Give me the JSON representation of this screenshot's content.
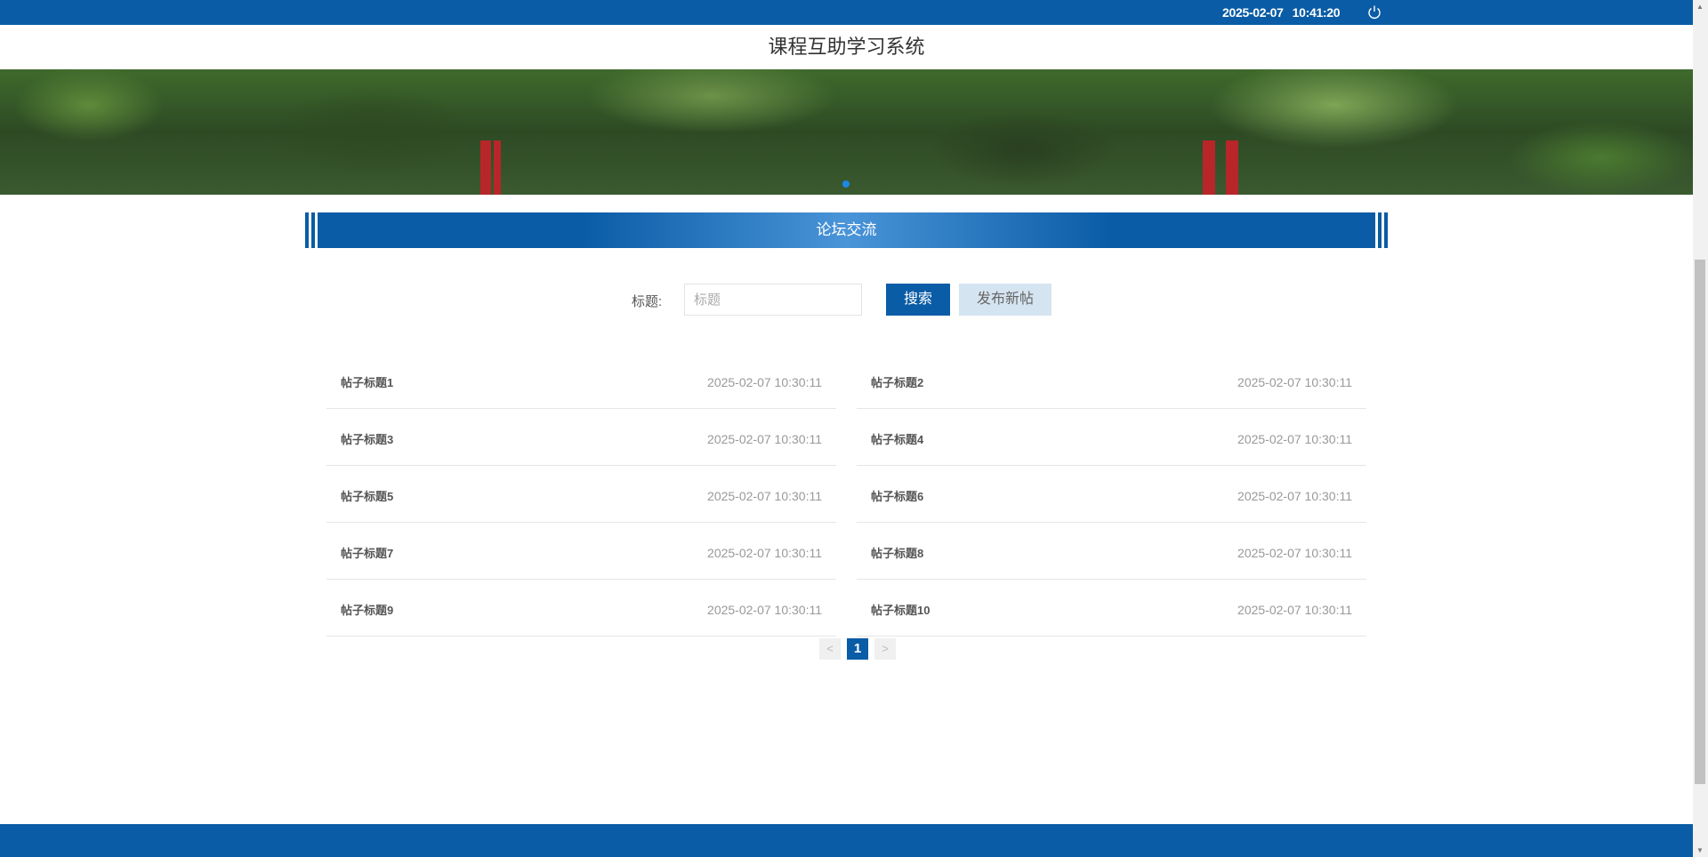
{
  "topbar": {
    "date": "2025-02-07",
    "time": "10:41:20",
    "logout_icon": "power-icon"
  },
  "header": {
    "title": "课程互助学习系统"
  },
  "section": {
    "title": "论坛交流"
  },
  "search": {
    "label": "标题:",
    "placeholder": "标题",
    "value": "",
    "search_button": "搜索",
    "publish_button": "发布新帖"
  },
  "posts": [
    {
      "title": "帖子标题1",
      "time": "2025-02-07 10:30:11"
    },
    {
      "title": "帖子标题2",
      "time": "2025-02-07 10:30:11"
    },
    {
      "title": "帖子标题3",
      "time": "2025-02-07 10:30:11"
    },
    {
      "title": "帖子标题4",
      "time": "2025-02-07 10:30:11"
    },
    {
      "title": "帖子标题5",
      "time": "2025-02-07 10:30:11"
    },
    {
      "title": "帖子标题6",
      "time": "2025-02-07 10:30:11"
    },
    {
      "title": "帖子标题7",
      "time": "2025-02-07 10:30:11"
    },
    {
      "title": "帖子标题8",
      "time": "2025-02-07 10:30:11"
    },
    {
      "title": "帖子标题9",
      "time": "2025-02-07 10:30:11"
    },
    {
      "title": "帖子标题10",
      "time": "2025-02-07 10:30:11"
    }
  ],
  "pagination": {
    "prev": "<",
    "current": "1",
    "next": ">"
  },
  "colors": {
    "primary": "#0a5ca6",
    "light_button": "#d5e4f1"
  }
}
